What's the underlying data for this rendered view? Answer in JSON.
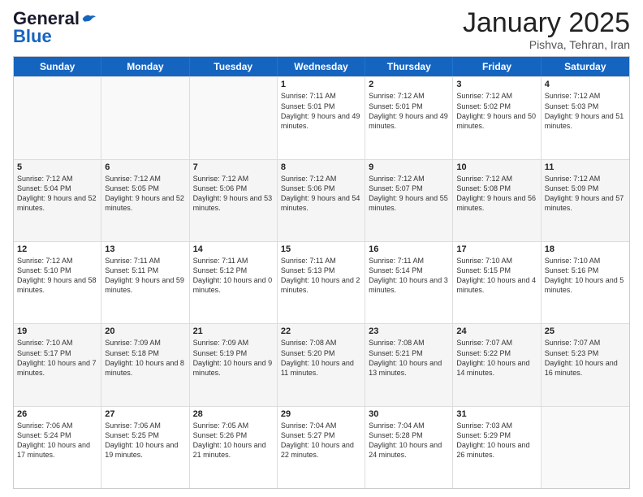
{
  "logo": {
    "part1": "General",
    "part2": "Blue"
  },
  "header": {
    "month": "January 2025",
    "location": "Pishva, Tehran, Iran"
  },
  "weekdays": [
    "Sunday",
    "Monday",
    "Tuesday",
    "Wednesday",
    "Thursday",
    "Friday",
    "Saturday"
  ],
  "rows": [
    [
      {
        "day": "",
        "info": ""
      },
      {
        "day": "",
        "info": ""
      },
      {
        "day": "",
        "info": ""
      },
      {
        "day": "1",
        "info": "Sunrise: 7:11 AM\nSunset: 5:01 PM\nDaylight: 9 hours and 49 minutes."
      },
      {
        "day": "2",
        "info": "Sunrise: 7:12 AM\nSunset: 5:01 PM\nDaylight: 9 hours and 49 minutes."
      },
      {
        "day": "3",
        "info": "Sunrise: 7:12 AM\nSunset: 5:02 PM\nDaylight: 9 hours and 50 minutes."
      },
      {
        "day": "4",
        "info": "Sunrise: 7:12 AM\nSunset: 5:03 PM\nDaylight: 9 hours and 51 minutes."
      }
    ],
    [
      {
        "day": "5",
        "info": "Sunrise: 7:12 AM\nSunset: 5:04 PM\nDaylight: 9 hours and 52 minutes."
      },
      {
        "day": "6",
        "info": "Sunrise: 7:12 AM\nSunset: 5:05 PM\nDaylight: 9 hours and 52 minutes."
      },
      {
        "day": "7",
        "info": "Sunrise: 7:12 AM\nSunset: 5:06 PM\nDaylight: 9 hours and 53 minutes."
      },
      {
        "day": "8",
        "info": "Sunrise: 7:12 AM\nSunset: 5:06 PM\nDaylight: 9 hours and 54 minutes."
      },
      {
        "day": "9",
        "info": "Sunrise: 7:12 AM\nSunset: 5:07 PM\nDaylight: 9 hours and 55 minutes."
      },
      {
        "day": "10",
        "info": "Sunrise: 7:12 AM\nSunset: 5:08 PM\nDaylight: 9 hours and 56 minutes."
      },
      {
        "day": "11",
        "info": "Sunrise: 7:12 AM\nSunset: 5:09 PM\nDaylight: 9 hours and 57 minutes."
      }
    ],
    [
      {
        "day": "12",
        "info": "Sunrise: 7:12 AM\nSunset: 5:10 PM\nDaylight: 9 hours and 58 minutes."
      },
      {
        "day": "13",
        "info": "Sunrise: 7:11 AM\nSunset: 5:11 PM\nDaylight: 9 hours and 59 minutes."
      },
      {
        "day": "14",
        "info": "Sunrise: 7:11 AM\nSunset: 5:12 PM\nDaylight: 10 hours and 0 minutes."
      },
      {
        "day": "15",
        "info": "Sunrise: 7:11 AM\nSunset: 5:13 PM\nDaylight: 10 hours and 2 minutes."
      },
      {
        "day": "16",
        "info": "Sunrise: 7:11 AM\nSunset: 5:14 PM\nDaylight: 10 hours and 3 minutes."
      },
      {
        "day": "17",
        "info": "Sunrise: 7:10 AM\nSunset: 5:15 PM\nDaylight: 10 hours and 4 minutes."
      },
      {
        "day": "18",
        "info": "Sunrise: 7:10 AM\nSunset: 5:16 PM\nDaylight: 10 hours and 5 minutes."
      }
    ],
    [
      {
        "day": "19",
        "info": "Sunrise: 7:10 AM\nSunset: 5:17 PM\nDaylight: 10 hours and 7 minutes."
      },
      {
        "day": "20",
        "info": "Sunrise: 7:09 AM\nSunset: 5:18 PM\nDaylight: 10 hours and 8 minutes."
      },
      {
        "day": "21",
        "info": "Sunrise: 7:09 AM\nSunset: 5:19 PM\nDaylight: 10 hours and 9 minutes."
      },
      {
        "day": "22",
        "info": "Sunrise: 7:08 AM\nSunset: 5:20 PM\nDaylight: 10 hours and 11 minutes."
      },
      {
        "day": "23",
        "info": "Sunrise: 7:08 AM\nSunset: 5:21 PM\nDaylight: 10 hours and 13 minutes."
      },
      {
        "day": "24",
        "info": "Sunrise: 7:07 AM\nSunset: 5:22 PM\nDaylight: 10 hours and 14 minutes."
      },
      {
        "day": "25",
        "info": "Sunrise: 7:07 AM\nSunset: 5:23 PM\nDaylight: 10 hours and 16 minutes."
      }
    ],
    [
      {
        "day": "26",
        "info": "Sunrise: 7:06 AM\nSunset: 5:24 PM\nDaylight: 10 hours and 17 minutes."
      },
      {
        "day": "27",
        "info": "Sunrise: 7:06 AM\nSunset: 5:25 PM\nDaylight: 10 hours and 19 minutes."
      },
      {
        "day": "28",
        "info": "Sunrise: 7:05 AM\nSunset: 5:26 PM\nDaylight: 10 hours and 21 minutes."
      },
      {
        "day": "29",
        "info": "Sunrise: 7:04 AM\nSunset: 5:27 PM\nDaylight: 10 hours and 22 minutes."
      },
      {
        "day": "30",
        "info": "Sunrise: 7:04 AM\nSunset: 5:28 PM\nDaylight: 10 hours and 24 minutes."
      },
      {
        "day": "31",
        "info": "Sunrise: 7:03 AM\nSunset: 5:29 PM\nDaylight: 10 hours and 26 minutes."
      },
      {
        "day": "",
        "info": ""
      }
    ]
  ]
}
